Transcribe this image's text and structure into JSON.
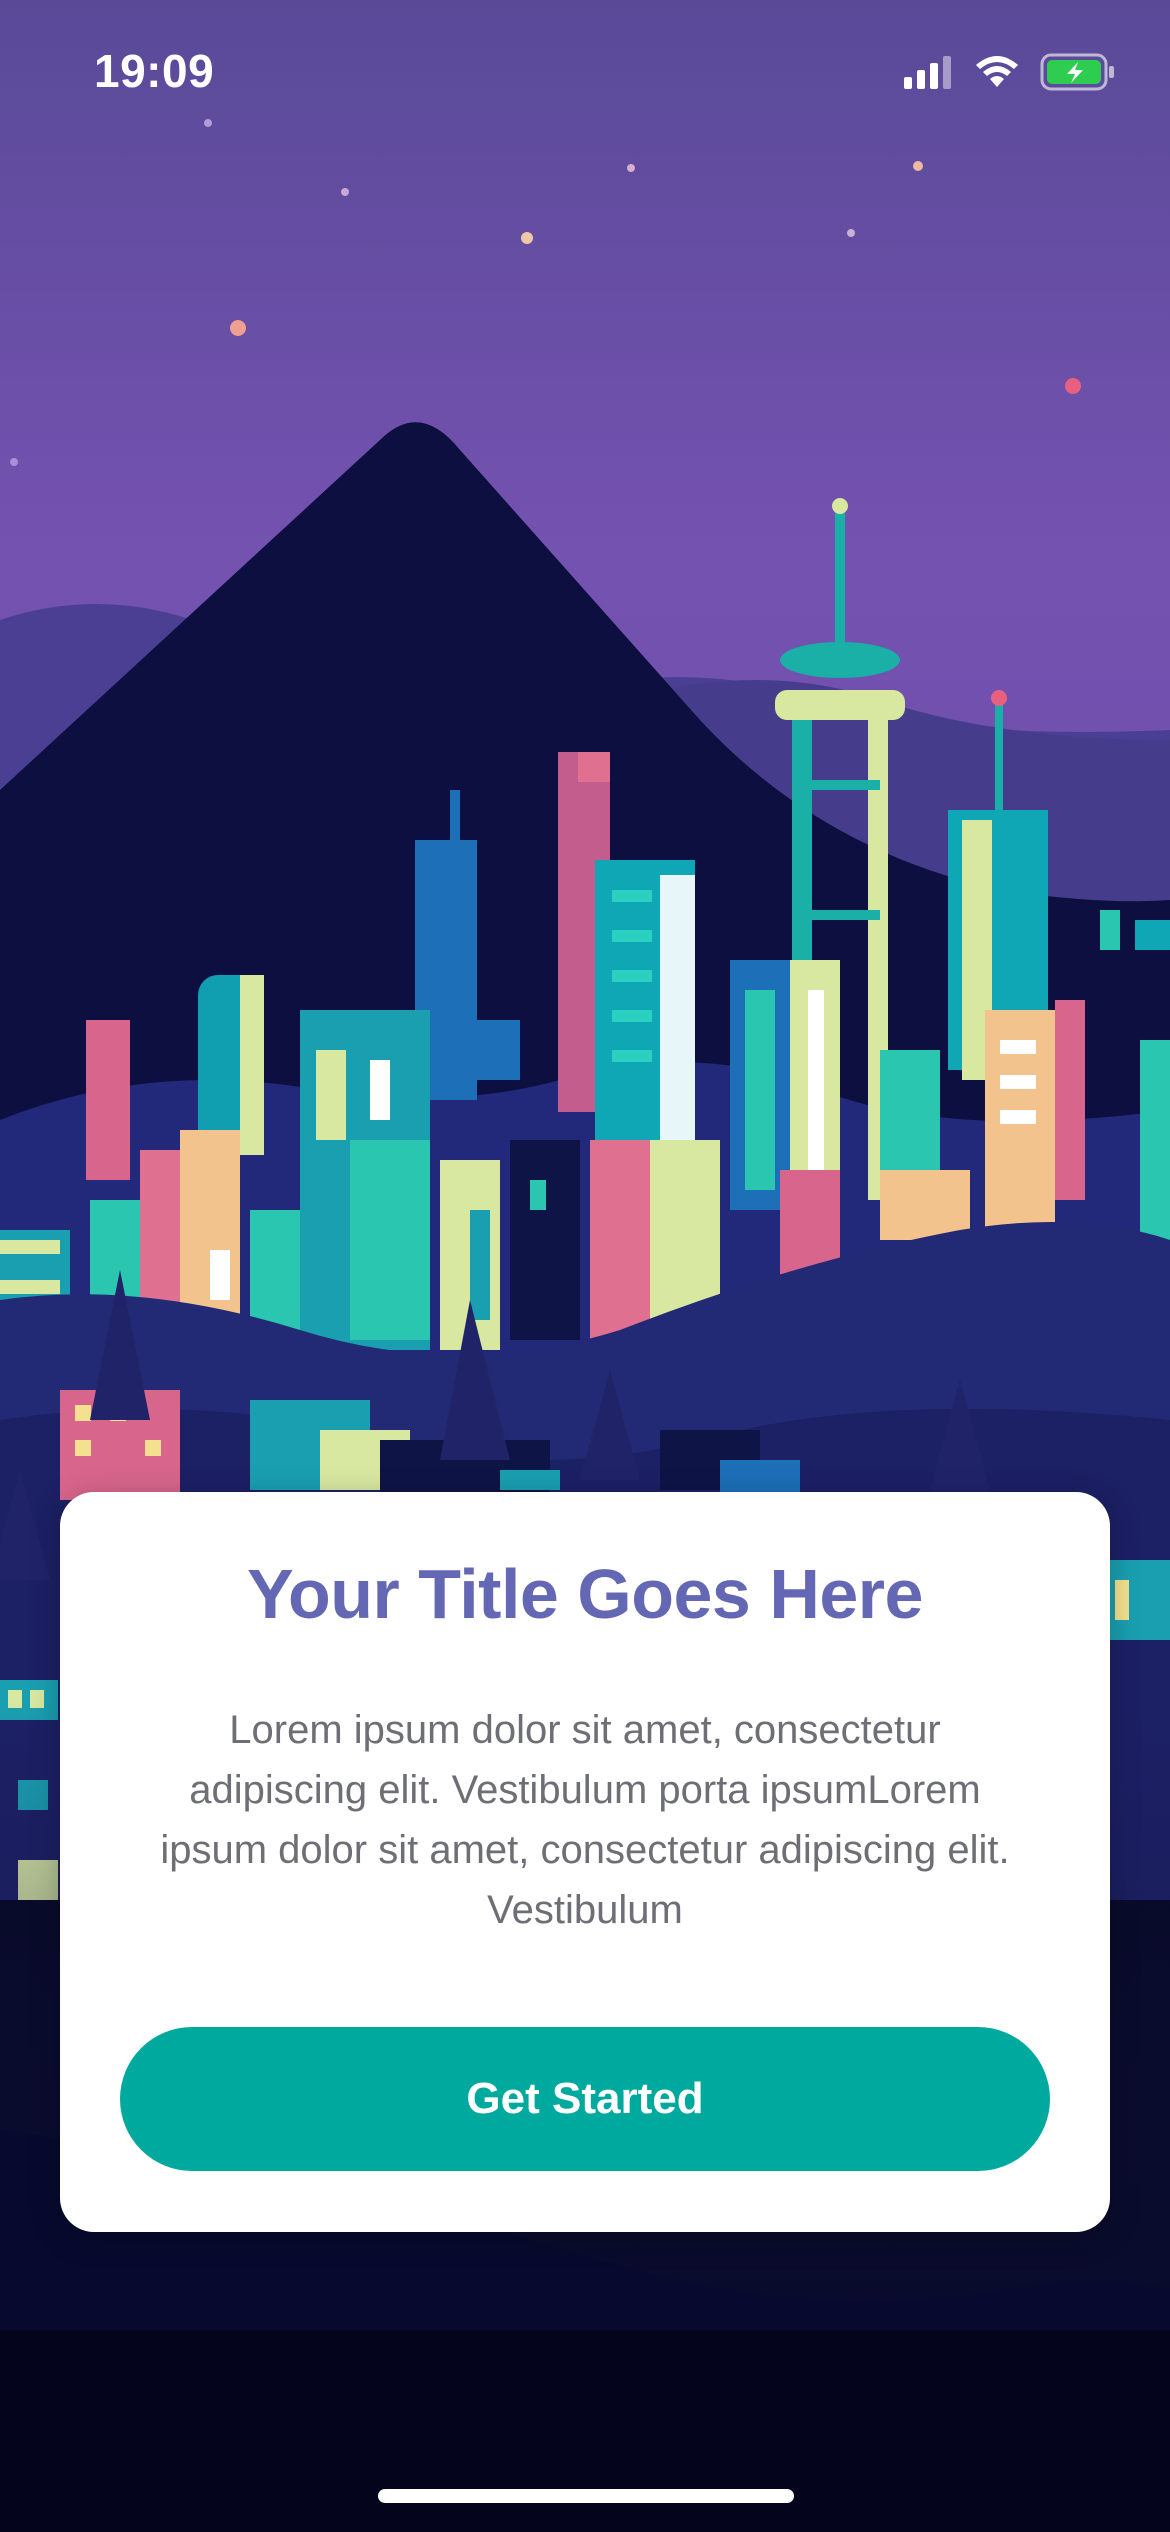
{
  "status_bar": {
    "time": "19:09",
    "icons": [
      "cellular-signal-icon",
      "wifi-icon",
      "battery-charging-icon"
    ]
  },
  "card": {
    "title": "Your Title Goes Here",
    "body": "Lorem ipsum dolor sit amet, consectetur adipiscing elit. Vestibulum porta ipsumLorem ipsum dolor sit amet, consectetur adipiscing elit. Vestibulum",
    "button_label": "Get Started"
  },
  "colors": {
    "sky_top": "#5b4a9c",
    "sky_bottom": "#7d55b6",
    "title": "#6468b4",
    "button": "#00a99e",
    "battery": "#2ecc4f"
  }
}
